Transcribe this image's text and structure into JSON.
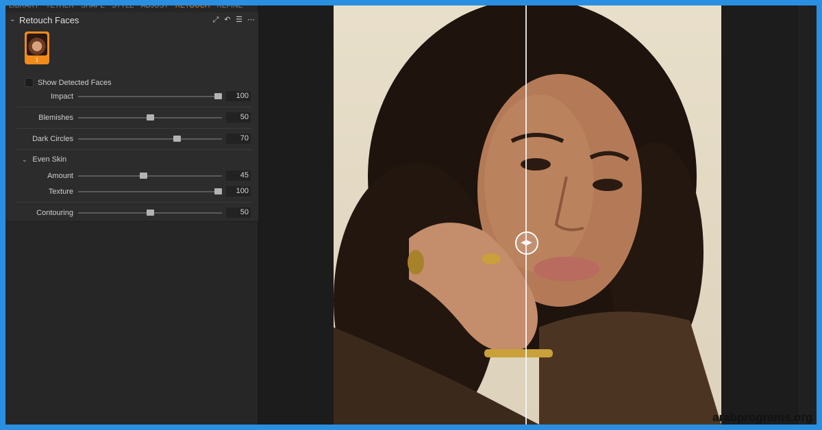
{
  "tabs": [
    "LIBRARY",
    "TETHER",
    "SHAPE",
    "STYLE",
    "ADJUST",
    "RETOUCH",
    "REFINE"
  ],
  "active_tab": "RETOUCH",
  "tool": {
    "title": "Retouch Faces",
    "icons": [
      "auto-adjust-icon",
      "undo-icon",
      "presets-icon",
      "more-icon"
    ],
    "face_thumbnail_index": "1",
    "show_detected_faces": {
      "label": "Show Detected Faces",
      "checked": false
    }
  },
  "sliders": {
    "impact": {
      "label": "Impact",
      "value": "100",
      "level": 1.0
    },
    "blemishes": {
      "label": "Blemishes",
      "value": "50",
      "level": 0.5
    },
    "dark_circles": {
      "label": "Dark Circles",
      "value": "70",
      "level": 0.7
    },
    "amount": {
      "label": "Amount",
      "value": "45",
      "level": 0.45
    },
    "texture": {
      "label": "Texture",
      "value": "100",
      "level": 1.0
    },
    "contouring": {
      "label": "Contouring",
      "value": "50",
      "level": 0.5
    }
  },
  "even_skin": {
    "label": "Even Skin"
  },
  "viewer": {
    "split_handle": "before-after-split"
  },
  "watermark": "arabprograms.org",
  "colors": {
    "accent": "#e58a2a",
    "frame": "#2a8fe0",
    "panel": "#2c2c2c"
  }
}
